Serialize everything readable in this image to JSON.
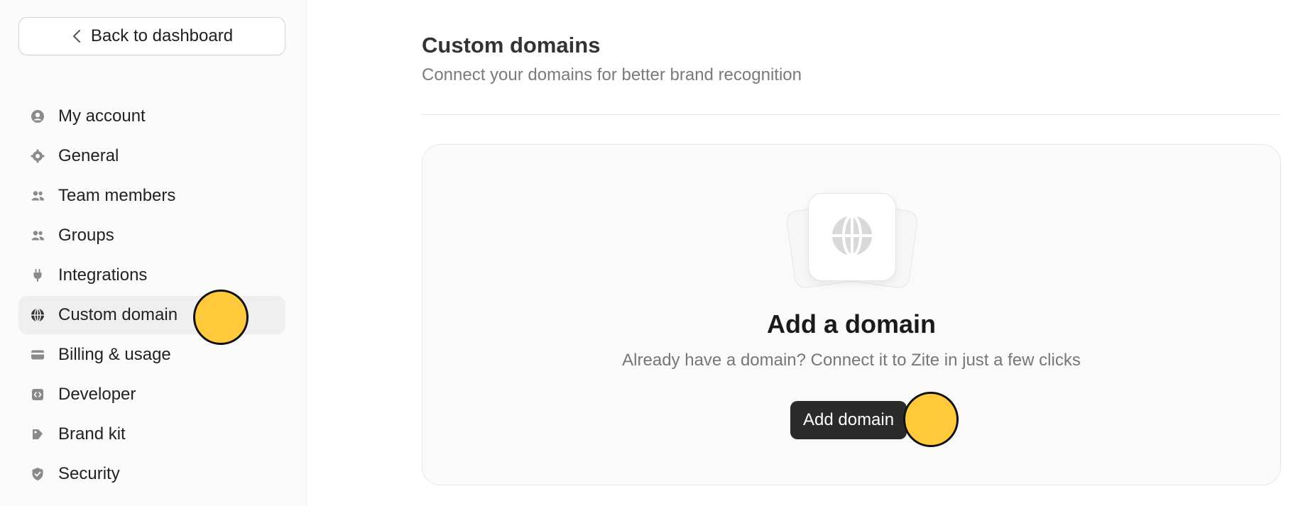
{
  "sidebar": {
    "back_label": "Back to dashboard",
    "items": [
      {
        "label": "My account",
        "icon": "user-circle-icon",
        "active": false
      },
      {
        "label": "General",
        "icon": "gear-icon",
        "active": false
      },
      {
        "label": "Team members",
        "icon": "users-icon",
        "active": false
      },
      {
        "label": "Groups",
        "icon": "users-icon",
        "active": false
      },
      {
        "label": "Integrations",
        "icon": "plug-icon",
        "active": false
      },
      {
        "label": "Custom domain",
        "icon": "globe-icon",
        "active": true
      },
      {
        "label": "Billing & usage",
        "icon": "credit-card-icon",
        "active": false
      },
      {
        "label": "Developer",
        "icon": "code-icon",
        "active": false
      },
      {
        "label": "Brand kit",
        "icon": "palette-icon",
        "active": false
      },
      {
        "label": "Security",
        "icon": "shield-icon",
        "active": false
      }
    ]
  },
  "main": {
    "title": "Custom domains",
    "subtitle": "Connect your domains for better brand recognition",
    "empty_state": {
      "icon": "globe-icon",
      "title": "Add a domain",
      "description": "Already have a domain? Connect it to Zite in just a few clicks",
      "button_label": "Add domain"
    }
  },
  "colors": {
    "marker": "#ffc93c",
    "primary_button": "#2b2b2b",
    "active_nav_bg": "#efefef"
  }
}
